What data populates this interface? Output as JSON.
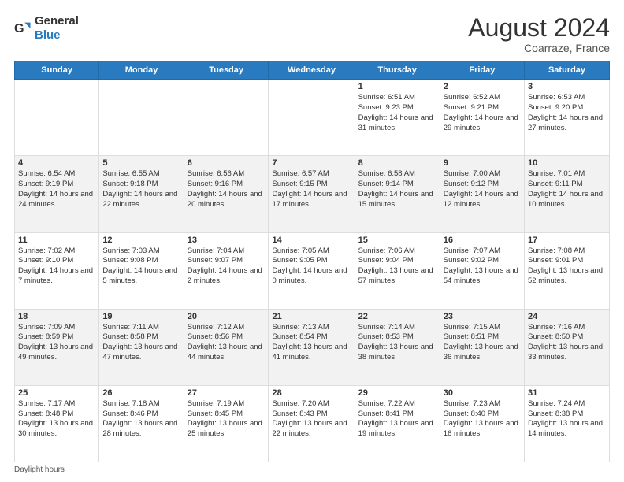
{
  "header": {
    "logo_general": "General",
    "logo_blue": "Blue",
    "month_year": "August 2024",
    "location": "Coarraze, France"
  },
  "days_of_week": [
    "Sunday",
    "Monday",
    "Tuesday",
    "Wednesday",
    "Thursday",
    "Friday",
    "Saturday"
  ],
  "footer": {
    "daylight_label": "Daylight hours"
  },
  "weeks": [
    [
      {
        "day": "",
        "sunrise": "",
        "sunset": "",
        "daylight": ""
      },
      {
        "day": "",
        "sunrise": "",
        "sunset": "",
        "daylight": ""
      },
      {
        "day": "",
        "sunrise": "",
        "sunset": "",
        "daylight": ""
      },
      {
        "day": "",
        "sunrise": "",
        "sunset": "",
        "daylight": ""
      },
      {
        "day": "1",
        "sunrise": "6:51 AM",
        "sunset": "9:23 PM",
        "daylight": "14 hours and 31 minutes."
      },
      {
        "day": "2",
        "sunrise": "6:52 AM",
        "sunset": "9:21 PM",
        "daylight": "14 hours and 29 minutes."
      },
      {
        "day": "3",
        "sunrise": "6:53 AM",
        "sunset": "9:20 PM",
        "daylight": "14 hours and 27 minutes."
      }
    ],
    [
      {
        "day": "4",
        "sunrise": "6:54 AM",
        "sunset": "9:19 PM",
        "daylight": "14 hours and 24 minutes."
      },
      {
        "day": "5",
        "sunrise": "6:55 AM",
        "sunset": "9:18 PM",
        "daylight": "14 hours and 22 minutes."
      },
      {
        "day": "6",
        "sunrise": "6:56 AM",
        "sunset": "9:16 PM",
        "daylight": "14 hours and 20 minutes."
      },
      {
        "day": "7",
        "sunrise": "6:57 AM",
        "sunset": "9:15 PM",
        "daylight": "14 hours and 17 minutes."
      },
      {
        "day": "8",
        "sunrise": "6:58 AM",
        "sunset": "9:14 PM",
        "daylight": "14 hours and 15 minutes."
      },
      {
        "day": "9",
        "sunrise": "7:00 AM",
        "sunset": "9:12 PM",
        "daylight": "14 hours and 12 minutes."
      },
      {
        "day": "10",
        "sunrise": "7:01 AM",
        "sunset": "9:11 PM",
        "daylight": "14 hours and 10 minutes."
      }
    ],
    [
      {
        "day": "11",
        "sunrise": "7:02 AM",
        "sunset": "9:10 PM",
        "daylight": "14 hours and 7 minutes."
      },
      {
        "day": "12",
        "sunrise": "7:03 AM",
        "sunset": "9:08 PM",
        "daylight": "14 hours and 5 minutes."
      },
      {
        "day": "13",
        "sunrise": "7:04 AM",
        "sunset": "9:07 PM",
        "daylight": "14 hours and 2 minutes."
      },
      {
        "day": "14",
        "sunrise": "7:05 AM",
        "sunset": "9:05 PM",
        "daylight": "14 hours and 0 minutes."
      },
      {
        "day": "15",
        "sunrise": "7:06 AM",
        "sunset": "9:04 PM",
        "daylight": "13 hours and 57 minutes."
      },
      {
        "day": "16",
        "sunrise": "7:07 AM",
        "sunset": "9:02 PM",
        "daylight": "13 hours and 54 minutes."
      },
      {
        "day": "17",
        "sunrise": "7:08 AM",
        "sunset": "9:01 PM",
        "daylight": "13 hours and 52 minutes."
      }
    ],
    [
      {
        "day": "18",
        "sunrise": "7:09 AM",
        "sunset": "8:59 PM",
        "daylight": "13 hours and 49 minutes."
      },
      {
        "day": "19",
        "sunrise": "7:11 AM",
        "sunset": "8:58 PM",
        "daylight": "13 hours and 47 minutes."
      },
      {
        "day": "20",
        "sunrise": "7:12 AM",
        "sunset": "8:56 PM",
        "daylight": "13 hours and 44 minutes."
      },
      {
        "day": "21",
        "sunrise": "7:13 AM",
        "sunset": "8:54 PM",
        "daylight": "13 hours and 41 minutes."
      },
      {
        "day": "22",
        "sunrise": "7:14 AM",
        "sunset": "8:53 PM",
        "daylight": "13 hours and 38 minutes."
      },
      {
        "day": "23",
        "sunrise": "7:15 AM",
        "sunset": "8:51 PM",
        "daylight": "13 hours and 36 minutes."
      },
      {
        "day": "24",
        "sunrise": "7:16 AM",
        "sunset": "8:50 PM",
        "daylight": "13 hours and 33 minutes."
      }
    ],
    [
      {
        "day": "25",
        "sunrise": "7:17 AM",
        "sunset": "8:48 PM",
        "daylight": "13 hours and 30 minutes."
      },
      {
        "day": "26",
        "sunrise": "7:18 AM",
        "sunset": "8:46 PM",
        "daylight": "13 hours and 28 minutes."
      },
      {
        "day": "27",
        "sunrise": "7:19 AM",
        "sunset": "8:45 PM",
        "daylight": "13 hours and 25 minutes."
      },
      {
        "day": "28",
        "sunrise": "7:20 AM",
        "sunset": "8:43 PM",
        "daylight": "13 hours and 22 minutes."
      },
      {
        "day": "29",
        "sunrise": "7:22 AM",
        "sunset": "8:41 PM",
        "daylight": "13 hours and 19 minutes."
      },
      {
        "day": "30",
        "sunrise": "7:23 AM",
        "sunset": "8:40 PM",
        "daylight": "13 hours and 16 minutes."
      },
      {
        "day": "31",
        "sunrise": "7:24 AM",
        "sunset": "8:38 PM",
        "daylight": "13 hours and 14 minutes."
      }
    ]
  ]
}
